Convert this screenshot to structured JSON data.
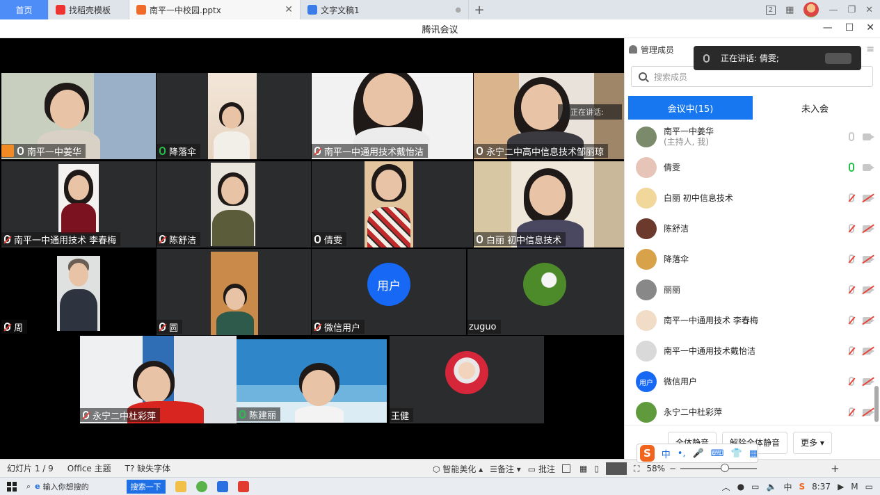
{
  "wps_tabs": {
    "home": "首页",
    "template": "找稻壳模板",
    "ppt": "南平一中校园.pptx",
    "doc": "文字文稿1",
    "new_tab": "+",
    "layout_badge": "2"
  },
  "meeting": {
    "title": "腾讯会议",
    "speaking_overlay": "正在讲话:",
    "tiles": [
      {
        "name": "南平一中姜华",
        "mic": "on"
      },
      {
        "name": "降落伞",
        "mic": "on"
      },
      {
        "name": "南平一中通用技术戴怡洁",
        "mic": "muted"
      },
      {
        "name": "永宁二中高中信息技术邹丽琼",
        "mic": "on"
      },
      {
        "name": "南平一中通用技术 李春梅",
        "mic": "muted"
      },
      {
        "name": "陈舒洁",
        "mic": "muted"
      },
      {
        "name": "倩雯",
        "mic": "on"
      },
      {
        "name": "白丽 初中信息技术",
        "mic": "on"
      },
      {
        "name": "周",
        "mic": "muted"
      },
      {
        "name": "圆",
        "mic": "muted"
      },
      {
        "name": "微信用户",
        "mic": "muted",
        "avatar_text": "用户"
      },
      {
        "name": "zuguo",
        "mic": "none"
      },
      {
        "name": "永宁二中杜彩萍",
        "mic": "muted"
      },
      {
        "name": "陈建丽",
        "mic": "on"
      },
      {
        "name": "王健",
        "mic": "none"
      }
    ]
  },
  "speaking": {
    "label": "正在讲话: 倩雯;"
  },
  "panel": {
    "title": "管理成员",
    "search_placeholder": "搜索成员",
    "tab_in": "会议中(15)",
    "tab_out": "未入会",
    "members": [
      {
        "name": "南平一中姜华",
        "sub": "(主持人, 我)",
        "mic": "off",
        "color": "#7a8a6a"
      },
      {
        "name": "倩雯",
        "sub": "",
        "mic": "on",
        "color": "#e7c4b8"
      },
      {
        "name": "白丽 初中信息技术",
        "sub": "",
        "mic": "muted",
        "color": "#f2d79a"
      },
      {
        "name": "陈舒洁",
        "sub": "",
        "mic": "muted",
        "color": "#6b3a2c"
      },
      {
        "name": "降落伞",
        "sub": "",
        "mic": "muted",
        "color": "#d8a24a"
      },
      {
        "name": "丽丽",
        "sub": "",
        "mic": "muted",
        "color": "#888888"
      },
      {
        "name": "南平一中通用技术 李春梅",
        "sub": "",
        "mic": "muted",
        "color": "#f1dcc8"
      },
      {
        "name": "南平一中通用技术戴怡洁",
        "sub": "",
        "mic": "muted",
        "color": "#d9d9d9"
      },
      {
        "name": "微信用户",
        "sub": "",
        "mic": "muted",
        "color": "#1668f5",
        "avatar_text": "用户"
      },
      {
        "name": "永宁二中杜彩萍",
        "sub": "",
        "mic": "muted",
        "color": "#5f9a3c"
      }
    ],
    "mute_all": "全体静音",
    "unmute_all": "解除全体静音",
    "more": "更多"
  },
  "status_bar": {
    "slide": "幻灯片 1 / 9",
    "theme": "Office 主题",
    "missing_font": "缺失字体",
    "beautify": "智能美化",
    "notes": "备注",
    "comment": "批注",
    "zoom": "58%",
    "zoom_level": 0.58
  },
  "ime": {
    "logo": "S",
    "mode": "中"
  },
  "taskbar": {
    "search_placeholder": "输入你想搜的",
    "search_button": "搜索一下",
    "time": "8:37",
    "ime_indicator": "中"
  },
  "colors": {
    "accent": "#1677f0",
    "wps_home": "#4e8cf7",
    "mic_on": "#27c14a",
    "mic_off": "#e8433a"
  }
}
